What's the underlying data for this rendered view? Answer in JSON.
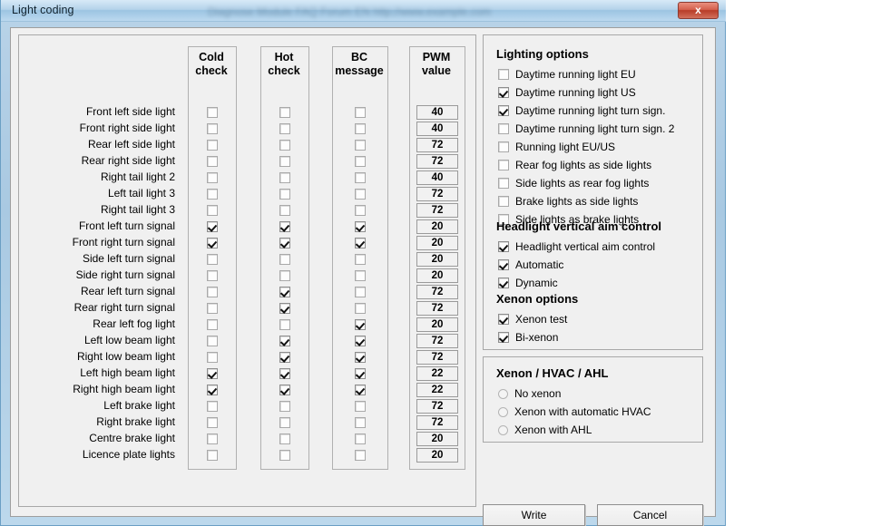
{
  "window": {
    "title": "Light coding",
    "blurred_background_text": "Diagnose Module    FAQ    Forum   EN    http://www.example.com",
    "close_label": "x"
  },
  "table": {
    "columns": [
      {
        "key": "cold",
        "header_line1": "Cold",
        "header_line2": "check"
      },
      {
        "key": "hot",
        "header_line1": "Hot",
        "header_line2": "check"
      },
      {
        "key": "bc",
        "header_line1": "BC",
        "header_line2": "message"
      },
      {
        "key": "pwm",
        "header_line1": "PWM",
        "header_line2": "value"
      }
    ],
    "rows": [
      {
        "label": "Front left side light",
        "cold": false,
        "hot": false,
        "bc": false,
        "pwm": "40"
      },
      {
        "label": "Front right side light",
        "cold": false,
        "hot": false,
        "bc": false,
        "pwm": "40"
      },
      {
        "label": "Rear left side light",
        "cold": false,
        "hot": false,
        "bc": false,
        "pwm": "72"
      },
      {
        "label": "Rear right side light",
        "cold": false,
        "hot": false,
        "bc": false,
        "pwm": "72"
      },
      {
        "label": "Right tail light 2",
        "cold": false,
        "hot": false,
        "bc": false,
        "pwm": "40"
      },
      {
        "label": "Left tail light 3",
        "cold": false,
        "hot": false,
        "bc": false,
        "pwm": "72"
      },
      {
        "label": "Right tail light 3",
        "cold": false,
        "hot": false,
        "bc": false,
        "pwm": "72"
      },
      {
        "label": "Front left turn signal",
        "cold": true,
        "hot": true,
        "bc": true,
        "pwm": "20"
      },
      {
        "label": "Front right turn signal",
        "cold": true,
        "hot": true,
        "bc": true,
        "pwm": "20"
      },
      {
        "label": "Side left turn signal",
        "cold": false,
        "hot": false,
        "bc": false,
        "pwm": "20"
      },
      {
        "label": "Side right turn signal",
        "cold": false,
        "hot": false,
        "bc": false,
        "pwm": "20"
      },
      {
        "label": "Rear left turn signal",
        "cold": false,
        "hot": true,
        "bc": false,
        "pwm": "72"
      },
      {
        "label": "Rear right turn signal",
        "cold": false,
        "hot": true,
        "bc": false,
        "pwm": "72"
      },
      {
        "label": "Rear left fog light",
        "cold": false,
        "hot": false,
        "bc": true,
        "pwm": "20"
      },
      {
        "label": "Left low beam light",
        "cold": false,
        "hot": true,
        "bc": true,
        "pwm": "72"
      },
      {
        "label": "Right low beam light",
        "cold": false,
        "hot": true,
        "bc": true,
        "pwm": "72"
      },
      {
        "label": "Left high beam light",
        "cold": true,
        "hot": true,
        "bc": true,
        "pwm": "22"
      },
      {
        "label": "Right high beam light",
        "cold": true,
        "hot": true,
        "bc": true,
        "pwm": "22"
      },
      {
        "label": "Left brake light",
        "cold": false,
        "hot": false,
        "bc": false,
        "pwm": "72"
      },
      {
        "label": "Right brake light",
        "cold": false,
        "hot": false,
        "bc": false,
        "pwm": "72"
      },
      {
        "label": "Centre brake light",
        "cold": false,
        "hot": false,
        "bc": false,
        "pwm": "20"
      },
      {
        "label": "Licence plate lights",
        "cold": false,
        "hot": false,
        "bc": false,
        "pwm": "20"
      }
    ]
  },
  "lighting_options": {
    "title": "Lighting options",
    "items": [
      {
        "label": "Daytime running light EU",
        "checked": false
      },
      {
        "label": "Daytime running light US",
        "checked": true
      },
      {
        "label": "Daytime running light turn sign.",
        "checked": true
      },
      {
        "label": "Daytime running light turn sign. 2",
        "checked": false
      },
      {
        "label": "Running light EU/US",
        "checked": false
      },
      {
        "label": "Rear fog lights as side lights",
        "checked": false
      },
      {
        "label": "Side lights as rear fog lights",
        "checked": false
      },
      {
        "label": "Brake lights as side lights",
        "checked": false
      },
      {
        "label": "Side lights as brake lights",
        "checked": false
      }
    ]
  },
  "headlight_aim": {
    "title": "Headlight vertical aim control",
    "items": [
      {
        "label": "Headlight vertical aim control",
        "checked": true
      },
      {
        "label": "Automatic",
        "checked": true
      },
      {
        "label": "Dynamic",
        "checked": true
      }
    ]
  },
  "xenon_options": {
    "title": "Xenon options",
    "items": [
      {
        "label": "Xenon test",
        "checked": true
      },
      {
        "label": "Bi-xenon",
        "checked": true
      }
    ]
  },
  "xenon_hvac_ahl": {
    "title": "Xenon / HVAC / AHL",
    "options": [
      {
        "label": "No xenon",
        "selected": false
      },
      {
        "label": "Xenon with automatic HVAC",
        "selected": false
      },
      {
        "label": "Xenon with AHL",
        "selected": false
      }
    ]
  },
  "buttons": {
    "write": "Write",
    "cancel": "Cancel"
  }
}
